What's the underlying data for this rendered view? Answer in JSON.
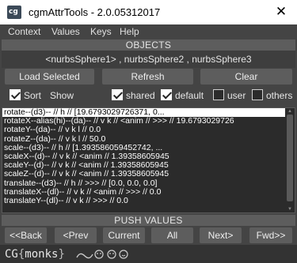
{
  "window": {
    "title": "cgmAttrTools - 2.0.05312017",
    "icon_label": "cg",
    "close_glyph": "✕"
  },
  "menu": [
    "Context",
    "Values",
    "Keys",
    "Help"
  ],
  "objects": {
    "header": "OBJECTS",
    "selection": "<nurbsSphere1> , nurbsSphere2 , nurbsSphere3",
    "load_selected": "Load Selected",
    "refresh": "Refresh",
    "clear": "Clear"
  },
  "options": {
    "sort": {
      "label": "Sort",
      "checked": true
    },
    "show_label": "Show",
    "shared": {
      "label": "shared",
      "checked": true
    },
    "default": {
      "label": "default",
      "checked": true
    },
    "user": {
      "label": "user",
      "checked": false
    },
    "others": {
      "label": "others",
      "checked": false
    }
  },
  "attributes": [
    "rotate--(d3)-- // h // [19.6793029726371, 0...",
    "rotateX--alias(hi)--(da)-- // v k // <anim // >>> // 19.6793029726",
    "rotateY--(da)-- // v k l // 0.0",
    "rotateZ--(da)-- // v k l // 50.0",
    "scale--(d3)-- // h // [1.393586059452742, ...",
    "scaleX--(d)-- // v k // <anim // 1.39358605945",
    "scaleY--(d)-- // v k // <anim // 1.39358605945",
    "scaleZ--(d)-- // v k // <anim // 1.39358605945",
    "translate--(d3)-- // h // >>> // [0.0, 0.0, 0.0]",
    "translateX--(dl)-- // v k // <anim // >>> // 0.0",
    "translateY--(dl)-- // v k // >>> // 0.0"
  ],
  "push": {
    "header": "PUSH VALUES",
    "buttons": [
      "<<Back",
      "<Prev",
      "Current",
      "All",
      "Next>",
      "Fwd>>"
    ]
  },
  "footer": {
    "logo_prefix": "CG",
    "logo_open": "{",
    "logo_word": "monks",
    "logo_close": "}"
  }
}
